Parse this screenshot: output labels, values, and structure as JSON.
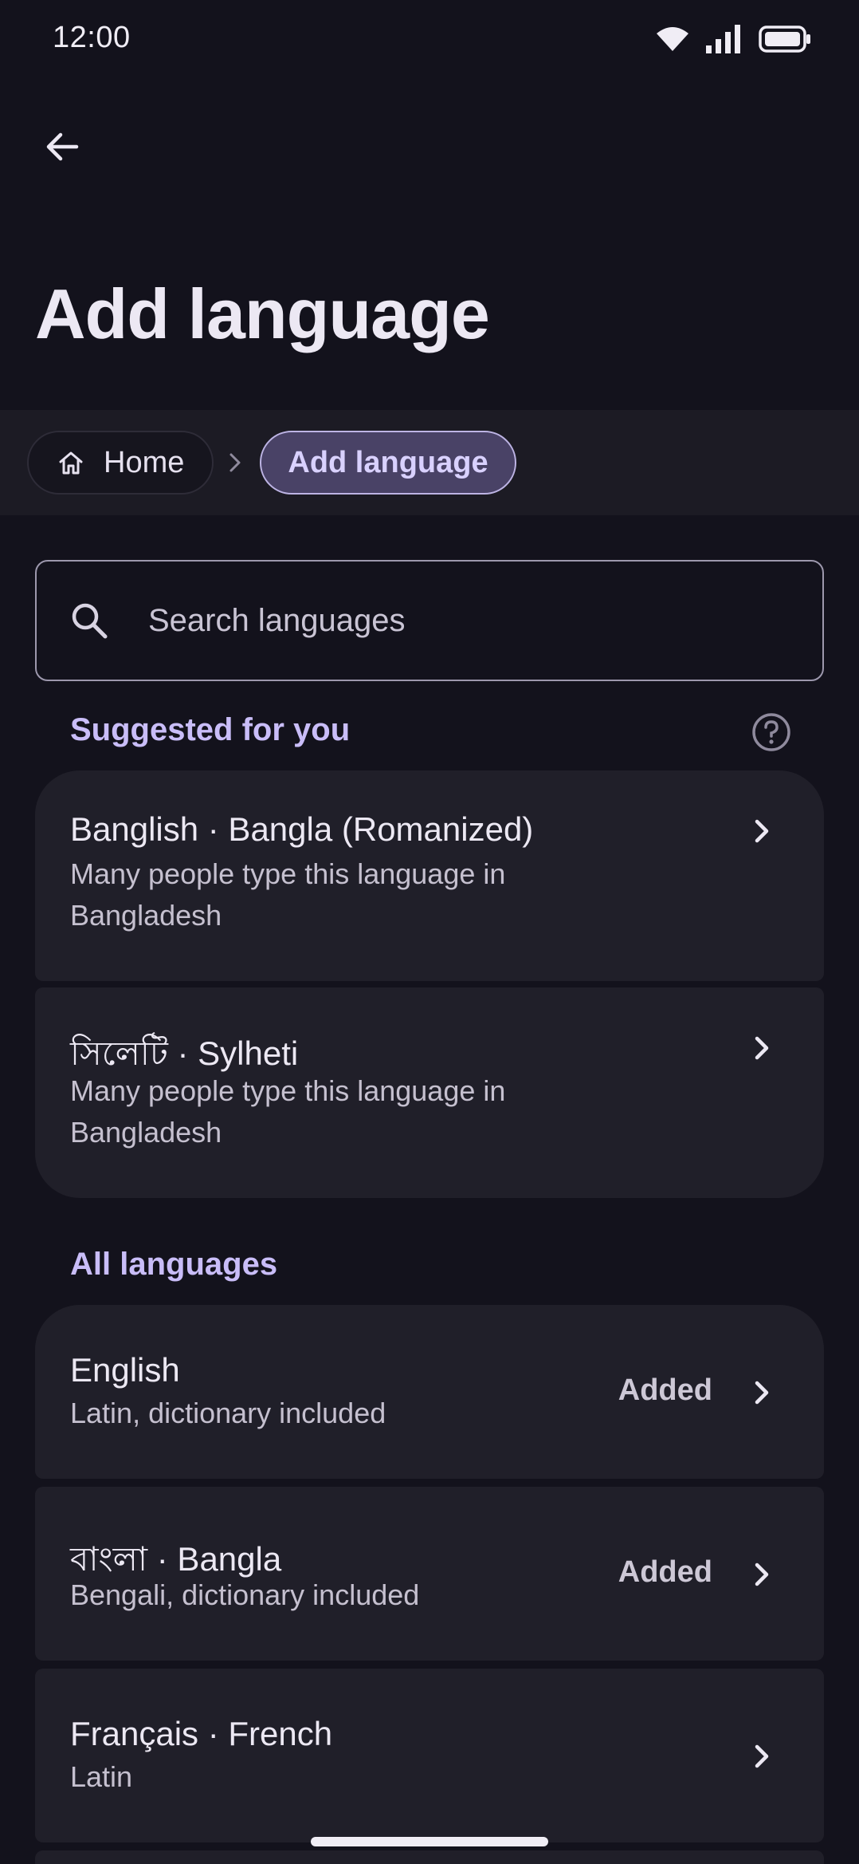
{
  "status_bar": {
    "time": "12:00",
    "icons": [
      "wifi-icon",
      "signal-icon",
      "battery-icon"
    ]
  },
  "header": {
    "back_icon": "arrow-back-icon",
    "title": "Add language"
  },
  "breadcrumb": {
    "home_label": "Home",
    "home_icon": "home-icon",
    "separator_icon": "chevron-right-icon",
    "current_label": "Add language"
  },
  "search": {
    "placeholder": "Search languages",
    "value": ""
  },
  "suggested": {
    "header": "Suggested for you",
    "help_icon": "help-circle-icon",
    "items": [
      {
        "title": "Banglish · Bangla (Romanized)",
        "subtitle": "Many people type this language in Bangladesh"
      },
      {
        "title": "সিলেটি · Sylheti",
        "subtitle": "Many people type this language in Bangladesh"
      }
    ]
  },
  "all_languages": {
    "header": "All languages",
    "items": [
      {
        "title": "English",
        "subtitle": "Latin, dictionary included",
        "status": "Added"
      },
      {
        "title": "বাংলা · Bangla",
        "subtitle": "Bengali, dictionary included",
        "status": "Added"
      },
      {
        "title": "Français · French",
        "subtitle": "Latin",
        "status": ""
      }
    ]
  },
  "colors": {
    "background": "#13121c",
    "surface": "#201f29",
    "accent": "#c9bdf8",
    "chip_selected": "#494266"
  }
}
